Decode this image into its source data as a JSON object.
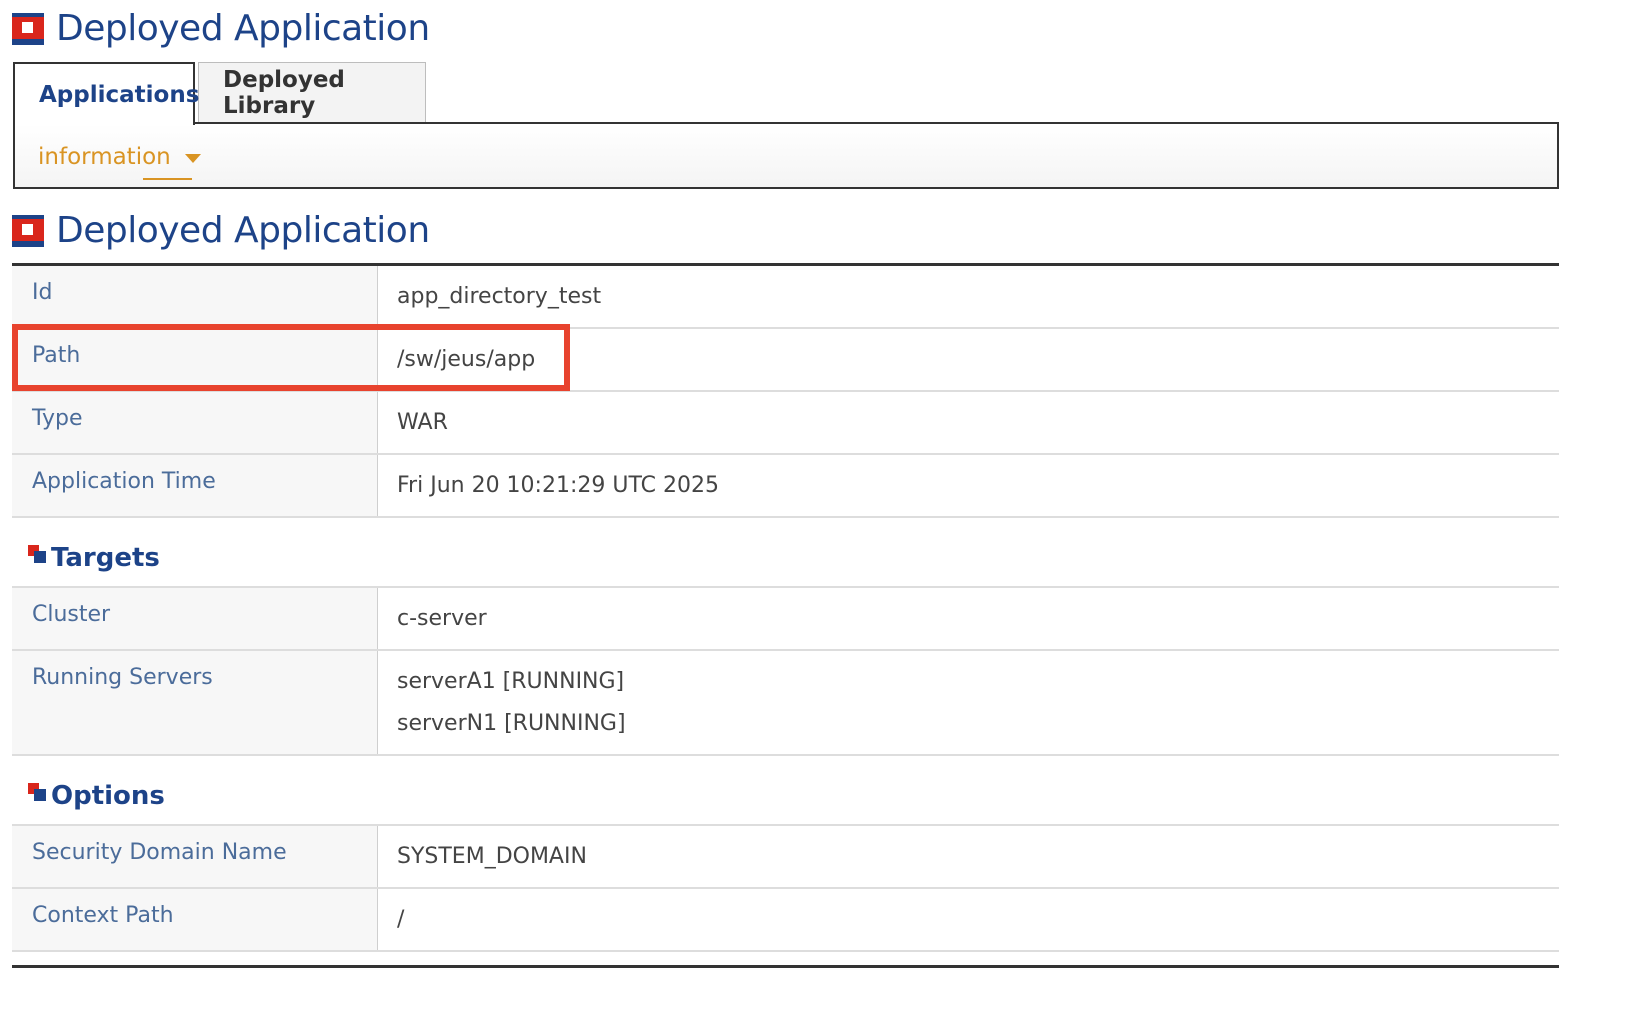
{
  "header": {
    "title": "Deployed Application"
  },
  "tabs": [
    {
      "label": "Applications",
      "active": true
    },
    {
      "label": "Deployed Library",
      "active": false
    }
  ],
  "subnav": {
    "label": "information"
  },
  "detail": {
    "title": "Deployed Application",
    "rows": {
      "id": {
        "label": "Id",
        "value": "app_directory_test"
      },
      "path": {
        "label": "Path",
        "value": "/sw/jeus/app"
      },
      "type": {
        "label": "Type",
        "value": "WAR"
      },
      "app_time": {
        "label": "Application Time",
        "value": "Fri Jun 20 10:21:29 UTC 2025"
      }
    },
    "targets": {
      "title": "Targets",
      "cluster": {
        "label": "Cluster",
        "value": "c-server"
      },
      "running_servers": {
        "label": "Running Servers",
        "values": [
          "serverA1 [RUNNING]",
          "serverN1 [RUNNING]"
        ]
      }
    },
    "options": {
      "title": "Options",
      "security_domain": {
        "label": "Security Domain Name",
        "value": "SYSTEM_DOMAIN"
      },
      "context_path": {
        "label": "Context Path",
        "value": "/"
      }
    }
  },
  "colors": {
    "title_blue": "#1d4388",
    "label_blue": "#4b6c9a",
    "accent_orange": "#d99423",
    "highlight_red": "#e8432e"
  },
  "icons": [
    "app-section-icon",
    "targets-section-icon",
    "options-section-icon",
    "dropdown-caret-icon"
  ]
}
